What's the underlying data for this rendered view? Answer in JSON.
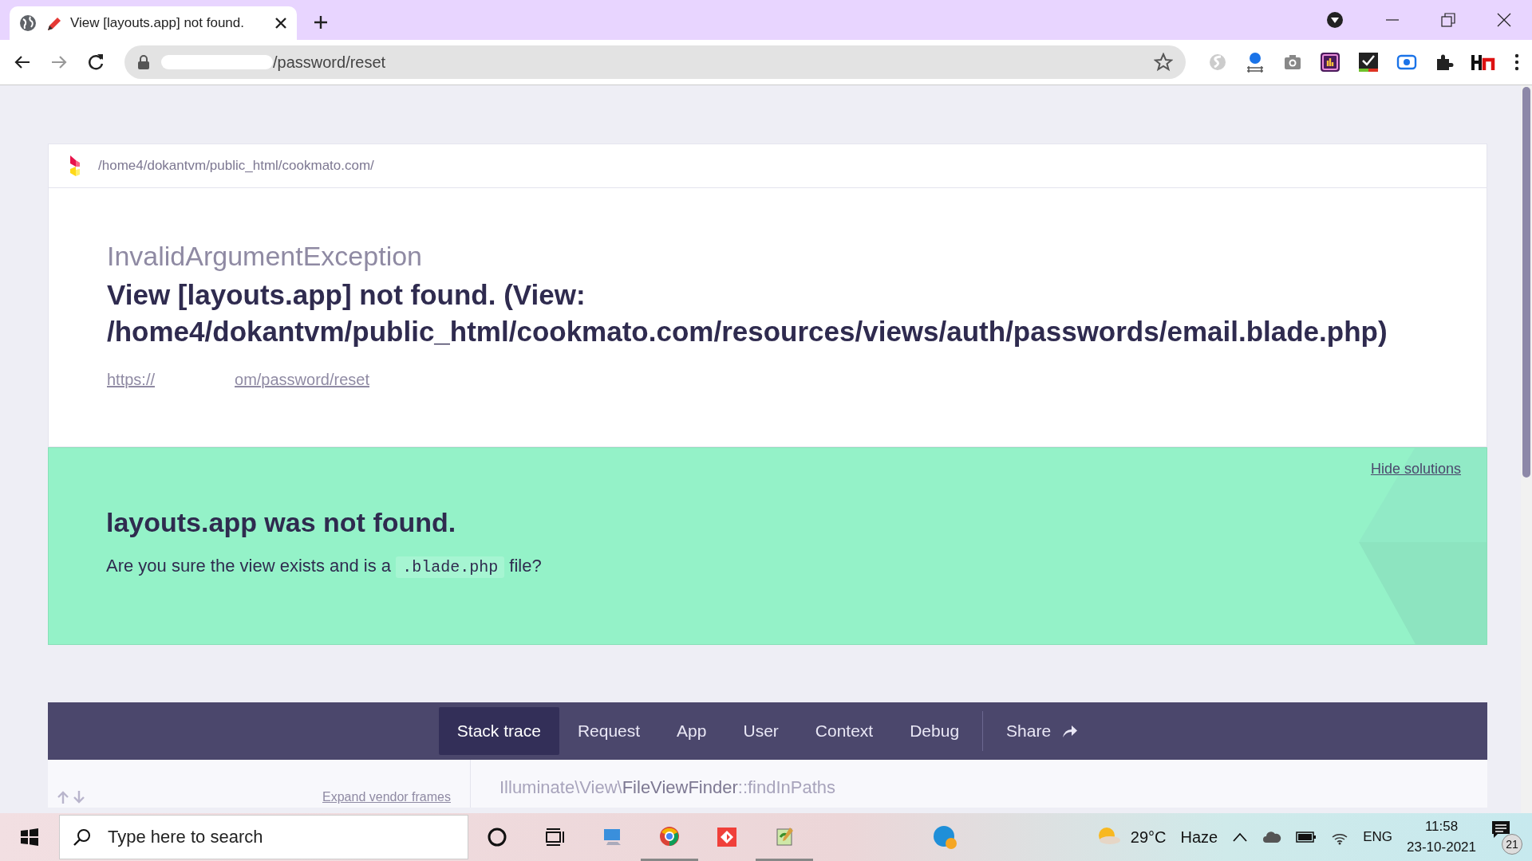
{
  "browser": {
    "tab": {
      "title": "View [layouts.app] not found.",
      "selected": true
    },
    "address": "/password/reset"
  },
  "error": {
    "app_path": "/home4/dokantvm/public_html/cookmato.com/",
    "exception": "InvalidArgumentException",
    "message": "View [layouts.app] not found. (View: /home4/dokantvm/public_html/cookmato.com/resources/views/auth/passwords/email.blade.php)",
    "url_start": "https://",
    "url_end": "om/password/reset"
  },
  "solution": {
    "hide_link": "Hide solutions",
    "title": "layouts.app was not found.",
    "text_before": "Are you sure the view exists and is a",
    "code": ".blade.php",
    "text_after": "file?"
  },
  "tabs": [
    {
      "label": "Stack trace",
      "selected": true,
      "kind": "tab"
    },
    {
      "label": "Request",
      "selected": false,
      "kind": "tab"
    },
    {
      "label": "App",
      "selected": false,
      "kind": "tab"
    },
    {
      "label": "User",
      "selected": false,
      "kind": "tab"
    },
    {
      "label": "Context",
      "selected": false,
      "kind": "tab"
    },
    {
      "label": "Debug",
      "selected": false,
      "kind": "tab"
    },
    {
      "label": "Share",
      "selected": false,
      "kind": "share"
    }
  ],
  "stack": {
    "expand": "Expand vendor frames",
    "frame_namespace": "Illuminate\\View\\",
    "frame_class": "FileViewFinder",
    "frame_method": "::findInPaths"
  },
  "taskbar": {
    "search_placeholder": "Type here to search",
    "temperature": "29°C",
    "condition": "Haze",
    "language": "ENG",
    "time": "11:58",
    "date": "23-10-2021",
    "notifications": "21"
  }
}
